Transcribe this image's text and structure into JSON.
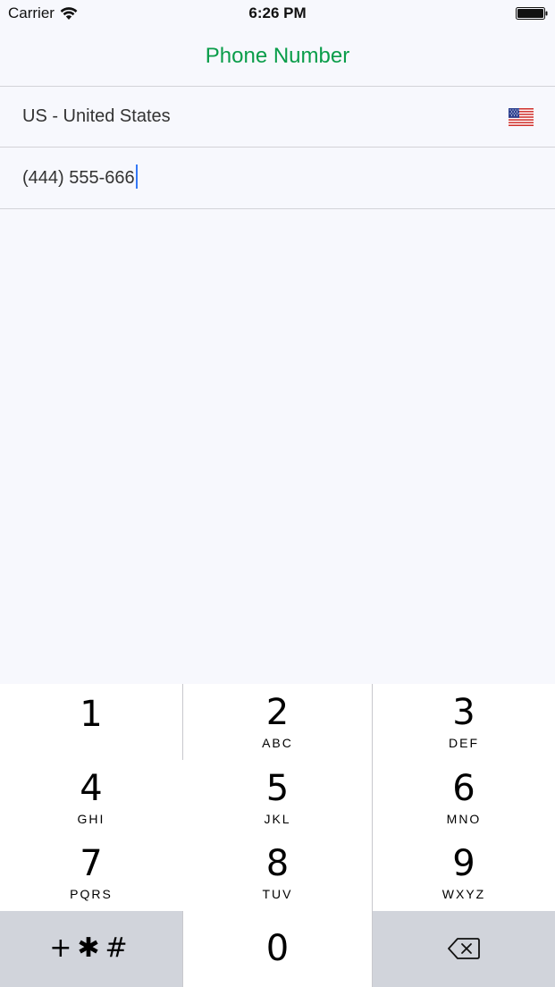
{
  "status_bar": {
    "carrier": "Carrier",
    "time": "6:26 PM"
  },
  "nav": {
    "title": "Phone Number"
  },
  "country_row": {
    "label": "US - United States",
    "flag_icon": "us-flag-icon"
  },
  "phone_row": {
    "value": "(444) 555-666"
  },
  "keypad": {
    "keys": [
      {
        "digit": "1",
        "letters": ""
      },
      {
        "digit": "2",
        "letters": "ABC"
      },
      {
        "digit": "3",
        "letters": "DEF"
      },
      {
        "digit": "4",
        "letters": "GHI"
      },
      {
        "digit": "5",
        "letters": "JKL"
      },
      {
        "digit": "6",
        "letters": "MNO"
      },
      {
        "digit": "7",
        "letters": "PQRS"
      },
      {
        "digit": "8",
        "letters": "TUV"
      },
      {
        "digit": "9",
        "letters": "WXYZ"
      },
      {
        "digit": "0",
        "letters": ""
      }
    ],
    "special_label": "+✱#",
    "backspace_icon": "backspace-icon"
  },
  "colors": {
    "accent": "#0a9d4a",
    "background": "#f7f8fd",
    "keypad_gray": "#d1d4db",
    "caret": "#3478f6"
  }
}
